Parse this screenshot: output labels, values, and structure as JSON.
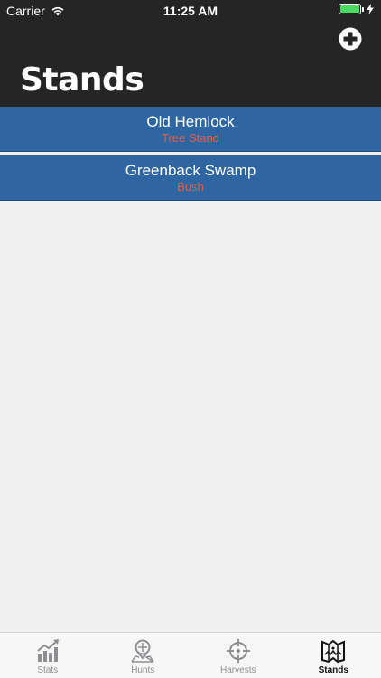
{
  "status_bar": {
    "carrier": "Carrier",
    "time": "11:25 AM",
    "battery_color": "#4cd964"
  },
  "header": {
    "title": "Stands",
    "add_icon": "plus-circle-icon",
    "background": "#252525"
  },
  "stands": [
    {
      "name": "Old Hemlock",
      "type": "Tree Stand"
    },
    {
      "name": "Greenback Swamp",
      "type": "Bush"
    }
  ],
  "colors": {
    "row_background": "#2f65a0",
    "type_text": "#e0604a",
    "page_background": "#f0f0f0"
  },
  "tabs": [
    {
      "label": "Stats",
      "icon": "stats-chart-icon",
      "active": false
    },
    {
      "label": "Hunts",
      "icon": "hunt-map-pin-icon",
      "active": false
    },
    {
      "label": "Harvests",
      "icon": "crosshair-icon",
      "active": false
    },
    {
      "label": "Stands",
      "icon": "stand-map-icon",
      "active": true
    }
  ]
}
